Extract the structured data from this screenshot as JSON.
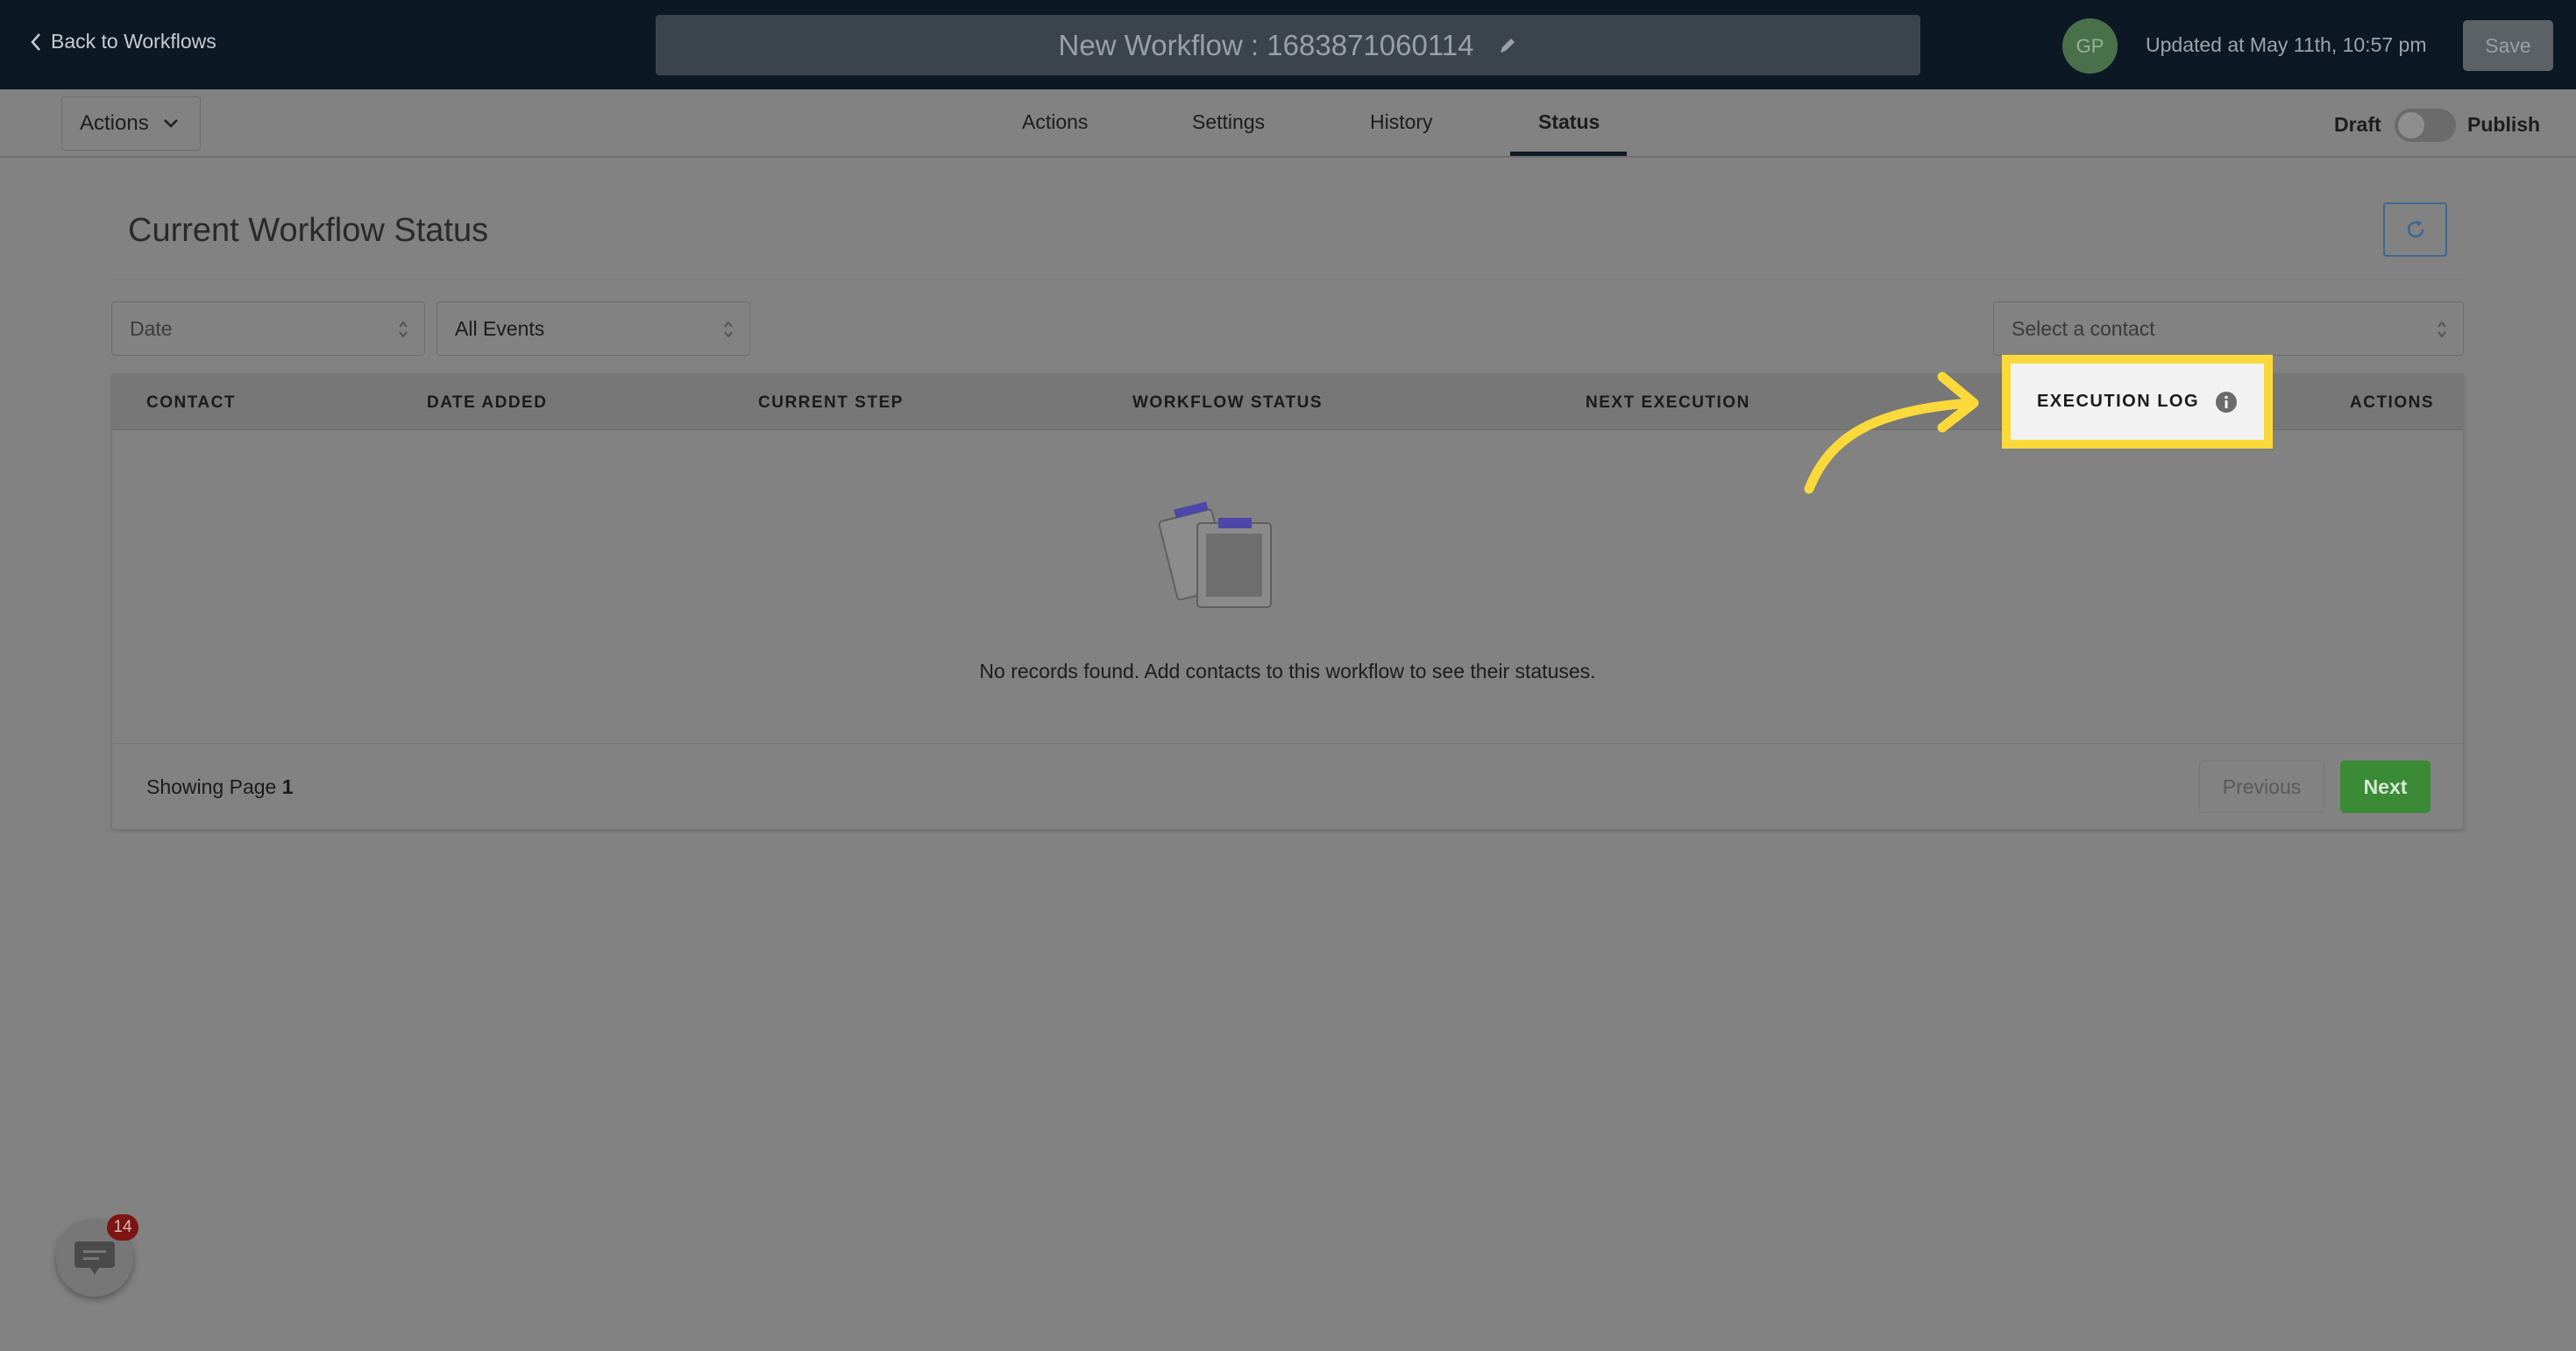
{
  "header": {
    "back_label": "Back to Workflows",
    "workflow_title": "New Workflow : 1683871060114",
    "avatar_initials": "GP",
    "updated_text": "Updated at May 11th, 10:57 pm",
    "save_label": "Save"
  },
  "subnav": {
    "actions_dropdown": "Actions",
    "tabs": [
      {
        "label": "Actions",
        "active": false
      },
      {
        "label": "Settings",
        "active": false
      },
      {
        "label": "History",
        "active": false
      },
      {
        "label": "Status",
        "active": true
      }
    ],
    "draft_label": "Draft",
    "publish_label": "Publish",
    "published": false
  },
  "main": {
    "title": "Current Workflow Status",
    "filters": {
      "date_placeholder": "Date",
      "events_value": "All Events",
      "contact_placeholder": "Select a contact"
    },
    "table": {
      "columns": [
        "CONTACT",
        "DATE ADDED",
        "CURRENT STEP",
        "WORKFLOW STATUS",
        "NEXT EXECUTION",
        "EXECUTION LOG",
        "ACTIONS"
      ],
      "empty_message": "No records found. Add contacts to this workflow to see their statuses.",
      "showing_label": "Showing Page",
      "page_number": "1",
      "previous_label": "Previous",
      "next_label": "Next"
    }
  },
  "chat": {
    "badge_count": "14"
  },
  "colors": {
    "highlight": "#fbd93a",
    "next_button": "#3b8a35",
    "topbar": "#0c1824"
  }
}
